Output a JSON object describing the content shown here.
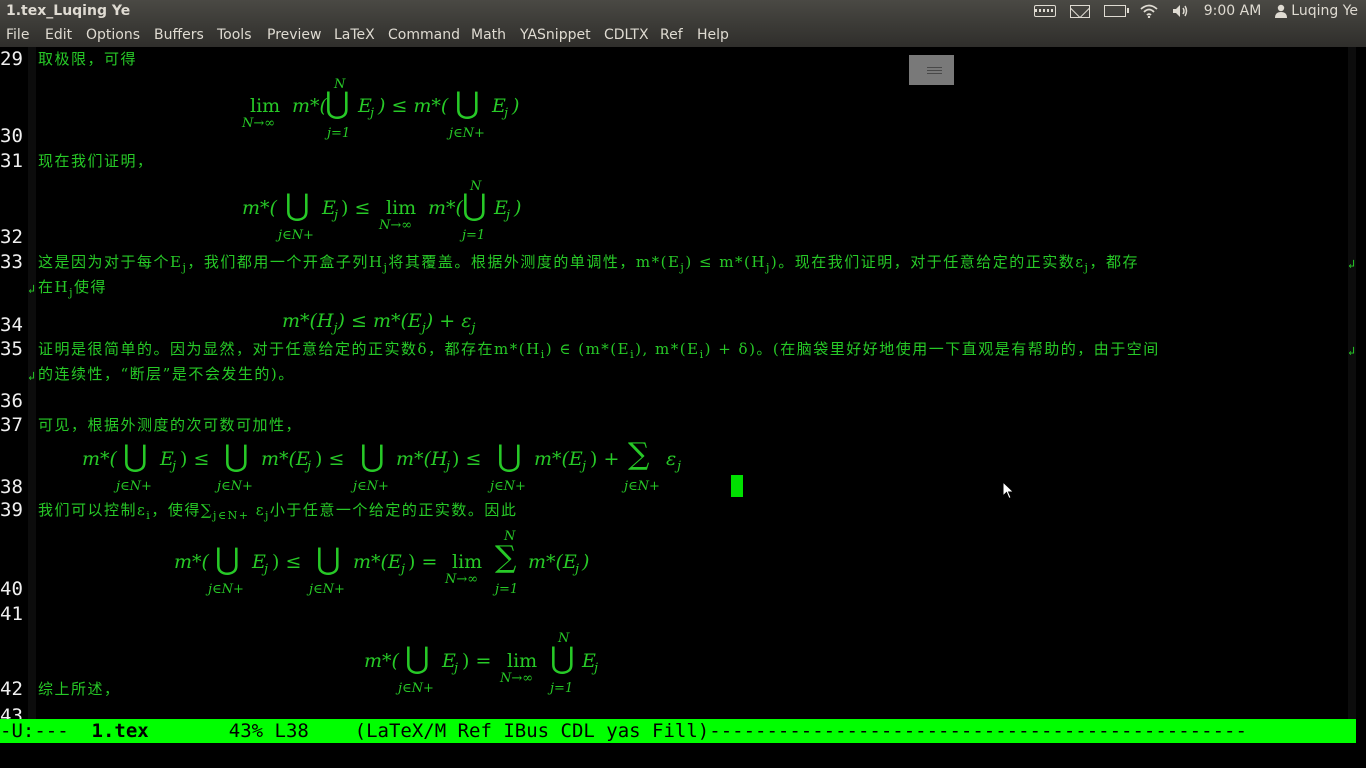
{
  "window": {
    "title": "1.tex_Luqing Ye"
  },
  "panel": {
    "time": "9:00 AM",
    "user": "Luqing Ye",
    "icons": [
      "keyboard-icon",
      "mail-icon",
      "battery-icon",
      "wifi-icon",
      "volume-icon",
      "user-icon"
    ]
  },
  "menu": [
    "File",
    "Edit",
    "Options",
    "Buffers",
    "Tools",
    "Preview",
    "LaTeX",
    "Command",
    "Math",
    "YASnippet",
    "CDLTX",
    "Ref",
    "Help"
  ],
  "lines": {
    "n29": "29",
    "n30": "30",
    "n31": "31",
    "n32": "32",
    "n33": "33",
    "n34": "34",
    "n35": "35",
    "n36": "36",
    "n37": "37",
    "n38": "38",
    "n39": "39",
    "n40": "40",
    "n41": "41",
    "n42": "42",
    "n43": "43"
  },
  "text": {
    "l29": "取极限，可得",
    "l31": "现在我们证明，",
    "l33a": "这是因为对于每个E",
    "l33b": "，我们都用一个开盒子列H",
    "l33c": "将其覆盖。根据外测度的单调性，m*(E",
    "l33d": ") ≤ m*(H",
    "l33e": ")。现在我们证明，对于任意给定的正实数ε",
    "l33f": "，都存",
    "l33g": "在H",
    "l33h": "使得",
    "l35a": "证明是很简单的。因为显然，对于任意给定的正实数δ，都存在m*(H",
    "l35b": ") ∈ (m*(E",
    "l35c": "), m*(E",
    "l35d": ") + δ)。(在脑袋里好好地使用一下直观是有帮助的，由于空间",
    "l35e": "的连续性，“断层”是不会发生的)。",
    "l37": "可见，根据外测度的次可数可加性，",
    "l39a": "我们可以控制ε",
    "l39b": "，使得∑",
    "l39c": " ε",
    "l39d": "小于任意一个给定的正实数。因此",
    "l42": "综上所述，"
  },
  "math": {
    "m1_lim": "lim",
    "m1_sub": "N→∞",
    "m1_a": "m*(",
    "m1_b": "E",
    "m1_c": ") ≤ m*(",
    "m1_d": "E",
    "m1_e": ")",
    "sup_N": "N",
    "sub_j1": "j=1",
    "sub_jN": "j∈N+",
    "sub_j": "j",
    "sub_i": "i",
    "m34": "m*(H",
    "m34b": ") ≤ m*(E",
    "m34c": ") + ε",
    "m38_a": "m*(",
    "m38_b": "E",
    "m38_c": ") ≤",
    "m38_d": "m*(E",
    "m38_e": ") ≤",
    "m38_f": "m*(H",
    "m38_g": ") ≤",
    "m38_h": "m*(E",
    "m38_i": ") +",
    "m38_j": "ε",
    "m40_a": "m*(",
    "m40_b": "E",
    "m40_c": ") ≤",
    "m40_d": "m*(E",
    "m40_e": ") =",
    "m40_f": "m*(E",
    "m40_g": ")",
    "m42_a": "m*(",
    "m42_b": "E",
    "m42_c": ") =",
    "m42_d": "E",
    "bigcup": "⋃",
    "sum": "∑",
    "wrap": "↲"
  },
  "modeline": {
    "flags": "-U:---  ",
    "buffer": "1.tex",
    "position": "43% L38",
    "modes": "(LaTeX/M Ref IBus CDL yas Fill)",
    "dashes": "-----------------------------------------------"
  }
}
